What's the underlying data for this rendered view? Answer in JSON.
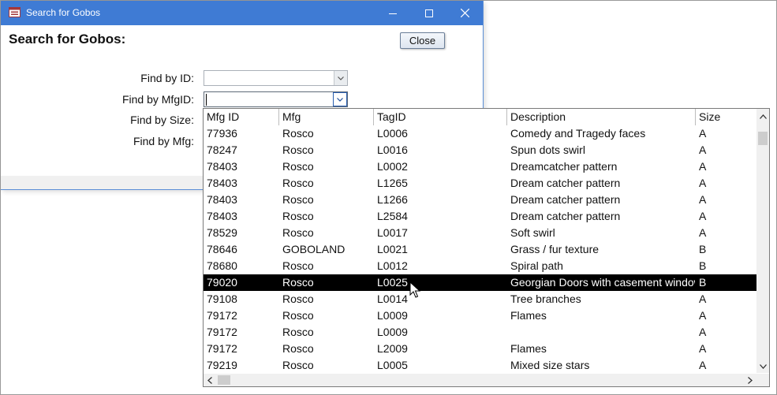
{
  "window": {
    "title": "Search for Gobos",
    "heading": "Search for Gobos:",
    "close_label": "Close"
  },
  "form": {
    "labels": [
      "Find by ID:",
      "Find by MfgID:",
      "Find by Size:",
      "Find by Mfg:"
    ]
  },
  "list": {
    "columns": [
      "Mfg ID",
      "Mfg",
      "TagID",
      "Description",
      "Size"
    ],
    "rows": [
      [
        "77936",
        "Rosco",
        "L0006",
        "Comedy and Tragedy faces",
        "A"
      ],
      [
        "78247",
        "Rosco",
        "L0016",
        "Spun dots swirl",
        "A"
      ],
      [
        "78403",
        "Rosco",
        "L0002",
        "Dreamcatcher pattern",
        "A"
      ],
      [
        "78403",
        "Rosco",
        "L1265",
        "Dream catcher pattern",
        "A"
      ],
      [
        "78403",
        "Rosco",
        "L1266",
        "Dream catcher pattern",
        "A"
      ],
      [
        "78403",
        "Rosco",
        "L2584",
        "Dream catcher pattern",
        "A"
      ],
      [
        "78529",
        "Rosco",
        "L0017",
        "Soft swirl",
        "A"
      ],
      [
        "78646",
        "GOBOLAND",
        "L0021",
        "Grass / fur texture",
        "B"
      ],
      [
        "78680",
        "Rosco",
        "L0012",
        "Spiral path",
        "B"
      ],
      [
        "79020",
        "Rosco",
        "L0025",
        "Georgian Doors with casement windows",
        "B"
      ],
      [
        "79108",
        "Rosco",
        "L0014",
        "Tree branches",
        "A"
      ],
      [
        "79172",
        "Rosco",
        "L0009",
        "Flames",
        "A"
      ],
      [
        "79172",
        "Rosco",
        "L0009",
        "",
        "A"
      ],
      [
        "79172",
        "Rosco",
        "L2009",
        "Flames",
        "A"
      ],
      [
        "79219",
        "Rosco",
        "L0005",
        "Mixed size stars",
        "A"
      ]
    ],
    "selected_index": 9
  }
}
